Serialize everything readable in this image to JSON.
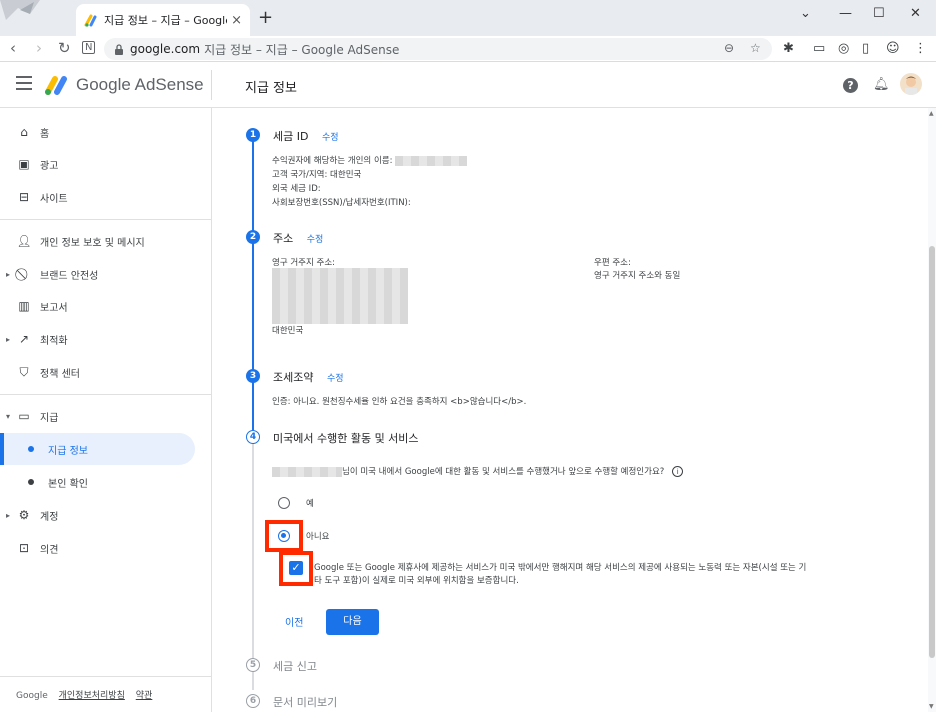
{
  "browser": {
    "tab_title": "지급 정보 – 지급 – Google AdSense",
    "url_domain": "google.com",
    "url_rest": "지급 정보 – 지급 – Google AdSense",
    "new_tab_glyph": "+",
    "close_tab_glyph": "×",
    "window_controls": [
      "⌄",
      "—",
      "☐",
      "✕"
    ]
  },
  "header": {
    "brand": "Google AdSense",
    "page_title": "지급 정보",
    "help_glyph": "?"
  },
  "sidebar": {
    "items": [
      {
        "label": "홈",
        "icon": "home-icon"
      },
      {
        "label": "광고",
        "icon": "ads-icon"
      },
      {
        "label": "사이트",
        "icon": "sites-icon"
      },
      {
        "label": "개인 정보 보호 및 메시지",
        "icon": "privacy-icon"
      },
      {
        "label": "브랜드 안전성",
        "icon": "block-icon"
      },
      {
        "label": "보고서",
        "icon": "reports-icon"
      },
      {
        "label": "최적화",
        "icon": "trending-icon"
      },
      {
        "label": "정책 센터",
        "icon": "policy-icon"
      },
      {
        "label": "지급",
        "icon": "payments-icon"
      },
      {
        "label": "지급 정보",
        "icon": "dot"
      },
      {
        "label": "본인 확인",
        "icon": "dot"
      },
      {
        "label": "계정",
        "icon": "gear-icon"
      },
      {
        "label": "의견",
        "icon": "feedback-icon"
      }
    ],
    "footer_brand": "Google",
    "footer_privacy": "개인정보처리방침",
    "footer_terms": "약관"
  },
  "steps": {
    "s1": {
      "num": "1",
      "title": "세금 ID",
      "edit": "수정",
      "line1": "수익권자에 해당하는 개인의 이름:",
      "line2": "고객 국가/지역: 대한민국",
      "line3": "외국 세금 ID:",
      "line4": "사회보장번호(SSN)/납세자번호(ITIN):"
    },
    "s2": {
      "num": "2",
      "title": "주소",
      "edit": "수정",
      "perm_label": "영구 거주지 주소:",
      "perm_country": "대한민국",
      "mail_label": "우편 주소:",
      "mail_value": "영구 거주지 주소와 동일"
    },
    "s3": {
      "num": "3",
      "title": "조세조약",
      "edit": "수정",
      "line1": "인증: 아니요. 원천징수세율 인하 요건을 충족하지 <b>않습니다</b>."
    },
    "s4": {
      "num": "4",
      "title": "미국에서 수행한 활동 및 서비스",
      "question": "님이 미국 내에서 Google에 대한 활동 및 서비스를 수행했거나 앞으로 수행할 예정인가요?",
      "info_glyph": "i",
      "opt_yes": "예",
      "opt_no": "아니요",
      "selected": "아니요",
      "certify_line1": "Google 또는 Google 제휴사에 제공하는 서비스가 미국 밖에서만 행해지며 해당 서비스의 제공에 사용되는 노동력 또는 자본(시설 또는 기",
      "certify_line2": "타 도구 포함)이 실제로 미국 외부에 위치함을 보증합니다.",
      "certify_checked": true,
      "prev": "이전",
      "next": "다음"
    },
    "s5": {
      "num": "5",
      "title": "세금 신고"
    },
    "s6": {
      "num": "6",
      "title": "문서 미리보기"
    }
  },
  "colors": {
    "accent": "#1a73e8",
    "highlight": "#ff2a00"
  }
}
